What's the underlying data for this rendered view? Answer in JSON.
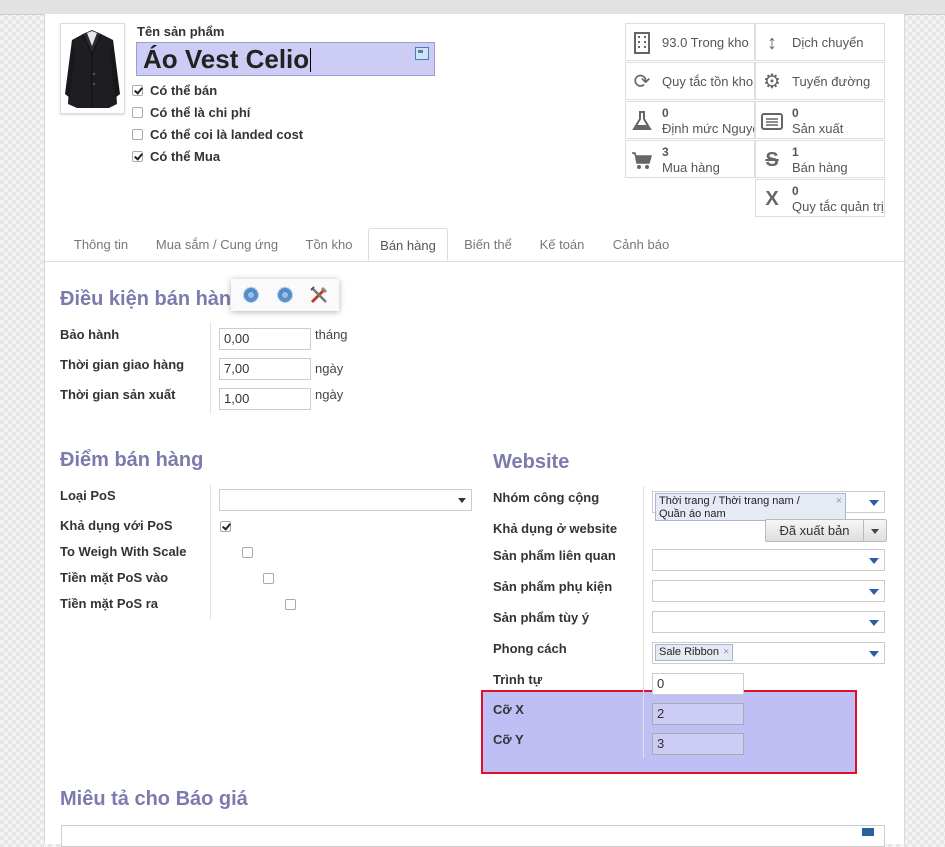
{
  "product": {
    "name_label": "Tên sản phẩm",
    "name_value": "Áo Vest Celio",
    "image": "suit-jacket-image"
  },
  "checkboxes": [
    {
      "label": "Có thể bán",
      "checked": true
    },
    {
      "label": "Có thể là chi phí",
      "checked": false
    },
    {
      "label": "Có thể coi là landed cost",
      "checked": false
    },
    {
      "label": "Có thể Mua",
      "checked": true
    }
  ],
  "smart_buttons": {
    "stock": {
      "label": "93.0 Trong kho",
      "icon": "building-icon"
    },
    "moves": {
      "label": "Dịch chuyển",
      "icon": "vertical-arrows-icon"
    },
    "reorder": {
      "label": "Quy tắc tồn kho",
      "icon": "refresh-icon"
    },
    "routes": {
      "label": "Tuyến đường",
      "icon": "gears-icon"
    },
    "bom": {
      "number": "0",
      "label": "Định mức Nguyên",
      "icon": "flask-icon"
    },
    "production": {
      "number": "0",
      "label": "Sản xuất",
      "icon": "list-icon"
    },
    "purchases": {
      "number": "3",
      "label": "Mua hàng",
      "icon": "cart-icon"
    },
    "sales": {
      "number": "1",
      "label": "Bán hàng",
      "icon": "strikethrough-s-icon"
    },
    "management": {
      "number": "0",
      "label": "Quy tắc quản trị",
      "icon": "x-logo-icon"
    }
  },
  "tabs": [
    "Thông tin",
    "Mua sắm / Cung ứng",
    "Tồn kho",
    "Bán hàng",
    "Biến thể",
    "Kế toán",
    "Cảnh báo"
  ],
  "active_tab": "Bán hàng",
  "sale_conditions": {
    "title": "Điều kiện bán hàn",
    "warranty": {
      "label": "Bảo hành",
      "value": "0,00",
      "unit": "tháng"
    },
    "delivery": {
      "label": "Thời gian giao hàng",
      "value": "7,00",
      "unit": "ngày"
    },
    "manufacturing": {
      "label": "Thời gian sản xuất",
      "value": "1,00",
      "unit": "ngày"
    }
  },
  "pos": {
    "title": "Điểm bán hàng",
    "category_label": "Loại PoS",
    "category_value": "",
    "available_label": "Khả dụng với PoS",
    "available_checked": true,
    "weigh_label": "To Weigh With Scale",
    "weigh_checked": false,
    "cash_in_label": "Tiền mặt PoS vào",
    "cash_in_checked": false,
    "cash_out_label": "Tiền mặt PoS ra",
    "cash_out_checked": false
  },
  "website": {
    "title": "Website",
    "public_category_label": "Nhóm công cộng",
    "public_category_tag_line1": "Thời trang / Thời trang nam /",
    "public_category_tag_line2": "Quần áo nam",
    "available_website_label": "Khả dụng ở website",
    "published_button": "Đã xuất bản",
    "related_label": "Sản phẩm liên quan",
    "accessory_label": "Sản phẩm phụ kiện",
    "optional_label": "Sản phẩm tùy ý",
    "style_label": "Phong cách",
    "style_tag": "Sale Ribbon",
    "sequence_label": "Trình tự",
    "sequence_value": "0",
    "size_x_label": "Cỡ X",
    "size_x_value": "2",
    "size_y_label": "Cỡ Y",
    "size_y_value": "3"
  },
  "quote_description": {
    "title": "Miêu tả cho Báo giá"
  },
  "colors": {
    "section_title": "#7c7bad",
    "highlight_border": "#e0102a",
    "highlight_fill": "#b4b4f5"
  }
}
